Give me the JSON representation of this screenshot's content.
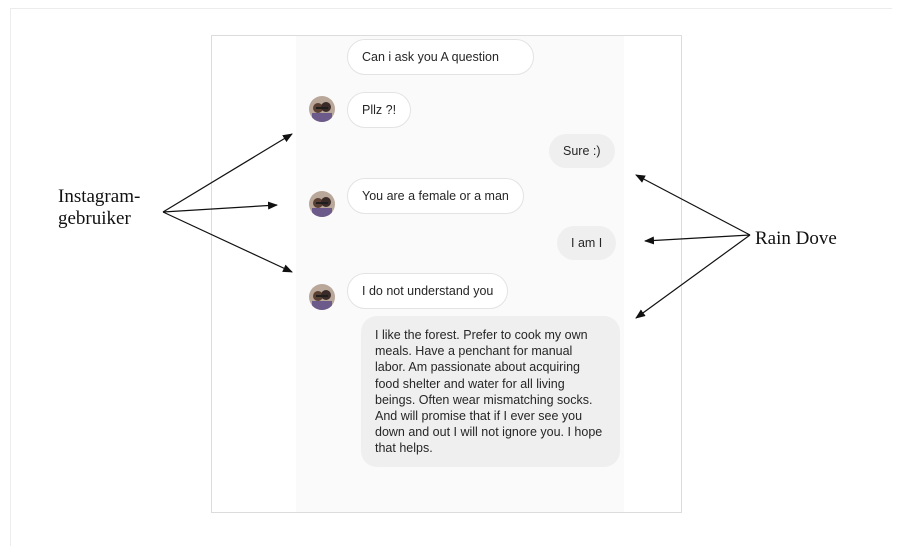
{
  "messages": [
    {
      "sender": "instagram",
      "text": "Can i ask you A question"
    },
    {
      "sender": "instagram",
      "text": "Pllz ?!"
    },
    {
      "sender": "rain",
      "text": "Sure :)"
    },
    {
      "sender": "instagram",
      "text": "You are a female or a man"
    },
    {
      "sender": "rain",
      "text": "I am I"
    },
    {
      "sender": "instagram",
      "text": "I do not understand you"
    },
    {
      "sender": "rain",
      "text": "I like the forest. Prefer to cook my own meals. Have a penchant for manual labor. Am passionate about acquiring food shelter and water for all living beings. Often wear mismatching socks. And will promise that if I ever see you down and out I will not ignore you. I hope that helps."
    }
  ],
  "labels": {
    "left_line1": "Instagram-",
    "left_line2": "gebruiker",
    "right": "Rain Dove"
  },
  "colors": {
    "incoming_bubble": "#ffffff",
    "outgoing_bubble": "#efefef",
    "text": "#262626",
    "arrow": "#111111"
  },
  "icons": {
    "avatar": "avatar-photo"
  }
}
